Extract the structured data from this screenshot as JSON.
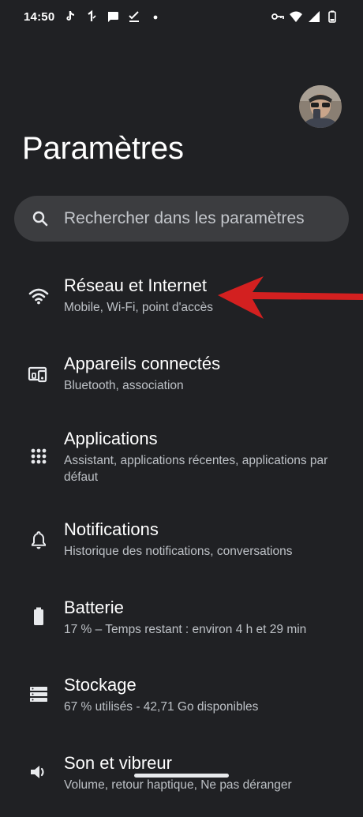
{
  "status_bar": {
    "time": "14:50",
    "left_icons": [
      "tiktok-icon",
      "signal-one-icon",
      "message-icon",
      "check-download-icon",
      "dot-icon"
    ],
    "right_icons": [
      "key-icon",
      "wifi-icon",
      "cell-signal-icon",
      "battery-icon"
    ]
  },
  "header": {
    "title": "Paramètres",
    "avatar": "user-avatar"
  },
  "search": {
    "placeholder": "Rechercher dans les paramètres"
  },
  "settings": [
    {
      "icon": "wifi-icon",
      "title": "Réseau et Internet",
      "subtitle": "Mobile, Wi-Fi, point d'accès"
    },
    {
      "icon": "connected-devices-icon",
      "title": "Appareils connectés",
      "subtitle": "Bluetooth, association"
    },
    {
      "icon": "apps-grid-icon",
      "title": "Applications",
      "subtitle": "Assistant, applications récentes, applications par défaut"
    },
    {
      "icon": "bell-icon",
      "title": "Notifications",
      "subtitle": "Historique des notifications, conversations"
    },
    {
      "icon": "battery-icon",
      "title": "Batterie",
      "subtitle": "17 % – Temps restant : environ 4 h et 29 min"
    },
    {
      "icon": "storage-icon",
      "title": "Stockage",
      "subtitle": "67 % utilisés - 42,71 Go disponibles"
    },
    {
      "icon": "sound-icon",
      "title": "Son et vibreur",
      "subtitle": "Volume, retour haptique, Ne pas déranger"
    }
  ],
  "colors": {
    "background": "#202124",
    "search_background": "#3c3d40",
    "annotation_arrow": "#d32020"
  }
}
